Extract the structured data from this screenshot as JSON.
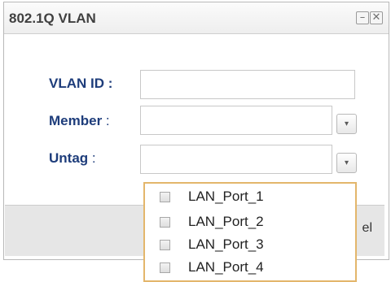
{
  "dialog": {
    "title": "802.1Q VLAN",
    "minimize_glyph": "–",
    "close_glyph": "✕"
  },
  "form": {
    "vlan_id_label": "VLAN ID :",
    "vlan_id_value": "",
    "member_label": "Member",
    "member_colon": ":",
    "member_value": "",
    "untag_label": "Untag",
    "untag_colon": ":",
    "untag_value": "",
    "dropdown_glyph": "▾"
  },
  "footer": {
    "cancel_partial": "el"
  },
  "untag_options": [
    {
      "label": "LAN_Port_1",
      "checked": false
    },
    {
      "label": "LAN_Port_2",
      "checked": false
    },
    {
      "label": "LAN_Port_3",
      "checked": false
    },
    {
      "label": "LAN_Port_4",
      "checked": false
    }
  ],
  "colors": {
    "label_blue": "#1e3d7b",
    "dropdown_border": "#e3b66b"
  }
}
